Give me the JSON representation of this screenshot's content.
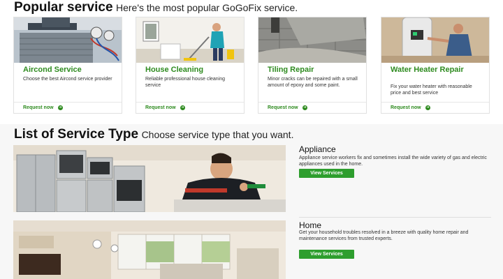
{
  "popular": {
    "heading": "Popular service",
    "subheading": "Here's the most popular GoGoFix service.",
    "cards": [
      {
        "title": "Aircond Service",
        "desc": "Choose the best Aircond service provider",
        "link": "Request now"
      },
      {
        "title": "House Cleaning",
        "desc": "Reliable professional house cleaning service",
        "link": "Request now"
      },
      {
        "title": "Tiling Repair",
        "desc": "Minor cracks can be repaired with a small amount of epoxy and some paint.",
        "link": "Request now"
      },
      {
        "title": "Water Heater Repair",
        "desc": "Fix your water heater with reasonable price and best service",
        "link": "Request now"
      }
    ]
  },
  "service_types": {
    "heading": "List of Service Type",
    "subheading": "Choose service type that you want.",
    "items": [
      {
        "title": "Appliance",
        "desc": "Appliance service workers fix and sometimes install the wide variety of gas and electric appliances used in the home.",
        "button": "View Services"
      },
      {
        "title": "Home",
        "desc": "Get your household troubles resolved in a breeze with quality home repair and maintenance services from trusted experts.",
        "button": "View Services"
      }
    ]
  },
  "colors": {
    "accent": "#2e8b1f",
    "button": "#2e9e2e"
  },
  "icons": {
    "card_link": "arrow-right-circle-icon"
  }
}
